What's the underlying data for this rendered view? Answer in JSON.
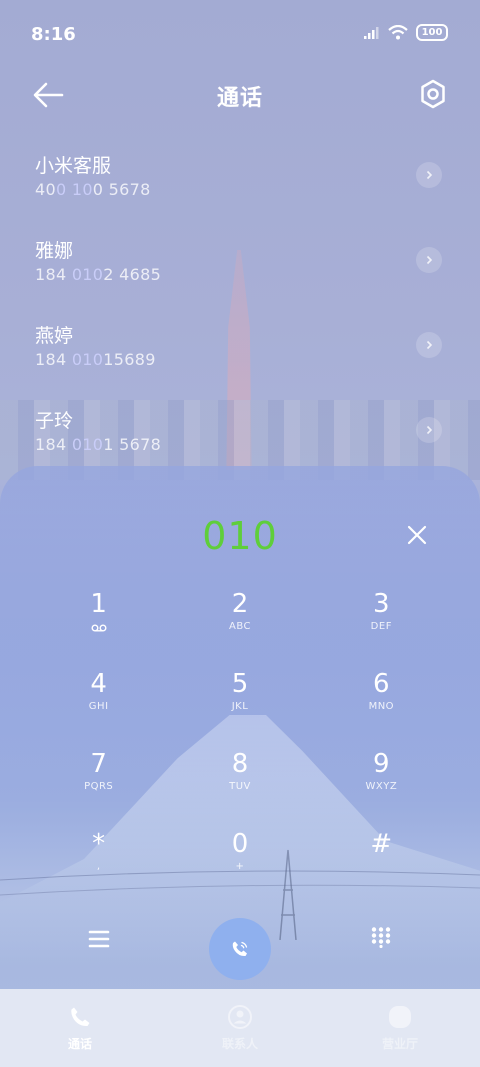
{
  "status_bar": {
    "time": "8:16",
    "battery": "100"
  },
  "header": {
    "title": "通话",
    "back_icon": "arrow-left-icon",
    "settings_icon": "gear-icon"
  },
  "contacts": [
    {
      "name": "小米客服",
      "num_a": "40",
      "num_b": "0 10",
      "num_c": "0 5678"
    },
    {
      "name": "雅娜",
      "num_a": "184 ",
      "num_b": "010",
      "num_c": "2 4685"
    },
    {
      "name": "燕婷",
      "num_a": "184 ",
      "num_b": "010",
      "num_c": "15689"
    },
    {
      "name": "子玲",
      "num_a": "184 ",
      "num_b": "010",
      "num_c": "1 5678"
    }
  ],
  "dialer": {
    "input": "010",
    "keys": [
      {
        "digit": "1",
        "letters": "voicemail-icon"
      },
      {
        "digit": "2",
        "letters": "ABC"
      },
      {
        "digit": "3",
        "letters": "DEF"
      },
      {
        "digit": "4",
        "letters": "GHI"
      },
      {
        "digit": "5",
        "letters": "JKL"
      },
      {
        "digit": "6",
        "letters": "MNO"
      },
      {
        "digit": "7",
        "letters": "PQRS"
      },
      {
        "digit": "8",
        "letters": "TUV"
      },
      {
        "digit": "9",
        "letters": "WXYZ"
      },
      {
        "digit": "*",
        "letters": ","
      },
      {
        "digit": "0",
        "letters": "+"
      },
      {
        "digit": "#",
        "letters": ""
      }
    ]
  },
  "bottom_nav": [
    {
      "label": "通话",
      "icon": "phone-icon",
      "active": true
    },
    {
      "label": "联系人",
      "icon": "contacts-icon",
      "active": false
    },
    {
      "label": "营业厅",
      "icon": "store-icon",
      "active": false
    }
  ],
  "colors": {
    "dial_text": "#5fce3a",
    "call_button": "#8fb0ee",
    "highlight": "#c9cdf8"
  }
}
